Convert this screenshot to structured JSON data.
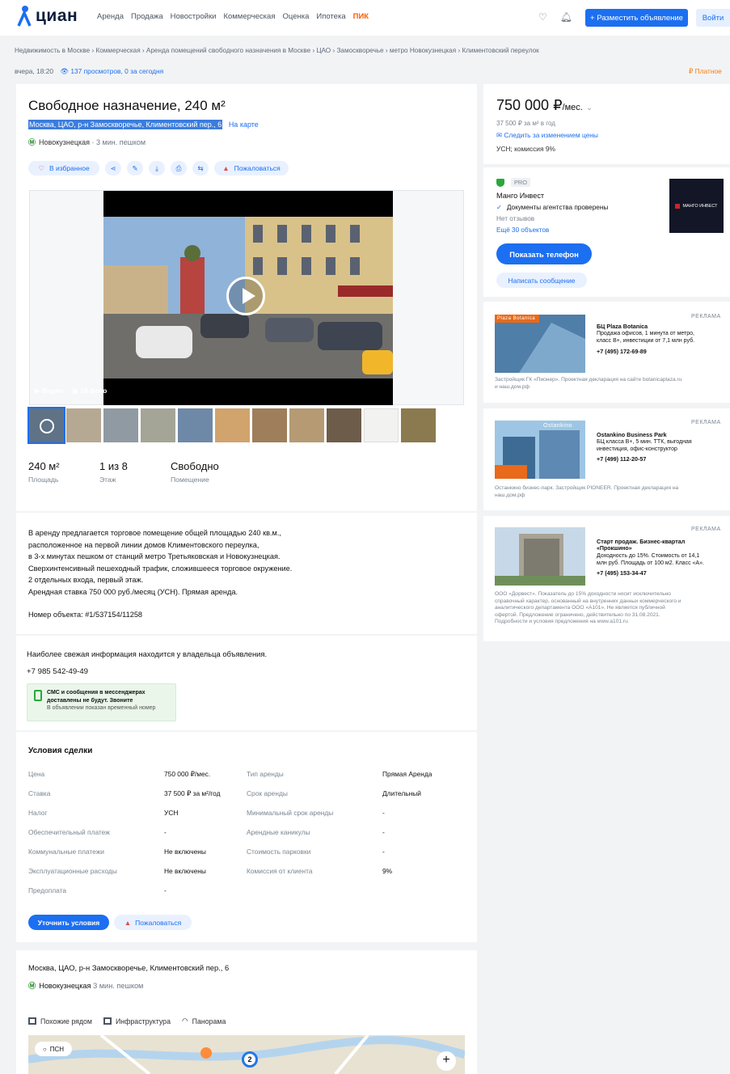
{
  "header": {
    "logo_text": "циан",
    "nav": [
      "Аренда",
      "Продажа",
      "Новостройки",
      "Коммерческая",
      "Оценка",
      "Ипотека"
    ],
    "pik": "ПИК",
    "post_button": "+ Разместить объявление",
    "login_button": "Войти"
  },
  "breadcrumbs": "Недвижимость в Москве  ›  Коммерческая  ›  Аренда помещений свободного назначения в Москве  ›  ЦАО  ›  Замоскворечье  ›  метро Новокузнецкая  ›  Климентовский переулок",
  "meta": {
    "date": "вчера, 18:20",
    "views": "137 просмотров, 0 за сегодня",
    "paid": "₽ Платное"
  },
  "listing": {
    "title": "Свободное назначение, 240 м²",
    "address": "Москва, ЦАО, р-н Замоскворечье, Климентовский пер., 6",
    "on_map": "На карте",
    "metro": "Новокузнецкая",
    "walk": "· 3 мин. пешком",
    "fav_label": "В избранное",
    "complain_label": "Пожаловаться",
    "video_label": "Видео",
    "photos_label": "10 фото",
    "stats": [
      {
        "value": "240 м²",
        "label": "Площадь"
      },
      {
        "value": "1 из 8",
        "label": "Этаж"
      },
      {
        "value": "Свободно",
        "label": "Помещение"
      }
    ],
    "description": [
      "В аренду предлагается торговое помещение общей площадью 240 кв.м.,",
      "расположенное на первой линии домов Климентовского переулка,",
      "в 3-х минутах пешком от станций метро Третьяковская и Новокузнецкая.",
      "Сверхинтенсивный пешеходный трафик, сложившееся торговое окружение.",
      "2 отдельных входа, первый этаж.",
      "Арендная ставка 750 000 руб./месяц (УСН). Прямая аренда."
    ],
    "object_number": "Номер объекта: #1/537154/11258"
  },
  "contact": {
    "fresh": "Наиболее свежая информация находится у владельца объявления.",
    "phone": "+7 985 542-49-49",
    "sms_line1": "СМС и сообщения в мессенджерах",
    "sms_line2": "доставлены не будут. Звоните",
    "sms_note": "В объявлении показан временный номер"
  },
  "deal": {
    "title": "Условия сделки",
    "rows": [
      {
        "l1": "Цена",
        "v1": "750 000 ₽/мес.",
        "l2": "Тип аренды",
        "v2": "Прямая Аренда"
      },
      {
        "l1": "Ставка",
        "v1": "37 500 ₽ за м²/год",
        "l2": "Срок аренды",
        "v2": "Длительный"
      },
      {
        "l1": "Налог",
        "v1": "УСН",
        "l2": "Минимальный срок аренды",
        "v2": "-"
      },
      {
        "l1": "Обеспечительный платеж",
        "v1": "-",
        "l2": "Арендные каникулы",
        "v2": "-"
      },
      {
        "l1": "Коммунальные платежи",
        "v1": "Не включены",
        "l2": "Стоимость парковки",
        "v2": "-"
      },
      {
        "l1": "Эксплуатационные расходы",
        "v1": "Не включены",
        "l2": "Комиссия от клиента",
        "v2": "9%"
      },
      {
        "l1": "Предоплата",
        "v1": "-",
        "l2": "",
        "v2": ""
      }
    ],
    "clarify_btn": "Уточнить условия",
    "complain_btn": "Пожаловаться"
  },
  "location": {
    "address": "Москва, ЦАО, р-н Замоскворечье, Климентовский пер., 6",
    "metro": "Новокузнецкая",
    "walk": "3 мин. пешком",
    "tabs": [
      "Похожие рядом",
      "Инфраструктура",
      "Панорама"
    ],
    "psn": "ПСН",
    "pin": "2",
    "zoom": "+"
  },
  "sidebar": {
    "price": "750 000 ₽",
    "price_unit": "/мес.",
    "ppm": "37 500 ₽ за м² в год",
    "follow": "Следить за изменением цены",
    "tax": "УСН; комиссия 9%",
    "pro": "PRO",
    "agency": "Манго Инвест",
    "verified": "Документы агентства проверены",
    "reviews": "Нет отзывов",
    "more": "Ещё 30 объектов",
    "logo_text": "МАНГО ИНВЕСТ",
    "call": "Показать телефон",
    "message": "Написать сообщение"
  },
  "ads": [
    {
      "tag": "РЕКЛАМА",
      "img_label": "Plaza Botanica",
      "title": "БЦ Plaza Botanica",
      "text": [
        "Продажа офисов, 1 минута от метро,",
        "класс B+, инвестиции от 7,1 млн руб."
      ],
      "phone": "+7 (495) 172-69-89",
      "foot": [
        "Застройщик ГК «Пионер». Проектная декларация на сайте botanicaplaza.ru",
        "и наш.дом.рф"
      ]
    },
    {
      "tag": "РЕКЛАМА",
      "img_label": "Ostankino",
      "title": "Ostankino Business Park",
      "text": [
        "БЦ класса B+, 5 мин. ТТК, выгодная",
        "инвестиция, офис-конструктор"
      ],
      "phone": "+7 (499) 112-20-57",
      "foot": [
        "Останкино бизнес-парк. Застройщик PIONEER. Проектная декларация на",
        "наш.дом.рф"
      ]
    },
    {
      "tag": "РЕКЛАМА",
      "img_label": "",
      "title": "Старт продаж. Бизнес-квартал",
      "text": [
        "«Прокшино»",
        "Доходность до 15%. Стоимость от 14,1",
        "млн руб. Площадь от 100 м2. Класс «А»."
      ],
      "phone": "+7 (495) 153-34-47",
      "foot": [
        "ООО «Дорвест». Показатель до 15% доходности носит исключительно",
        "справочный характер, основанный на внутренних данных коммерческого и",
        "аналитического департамента ООО «А101». Не является публичной",
        "офертой. Предложение ограничено, действительно по 31.08.2021.",
        "Подробности и условия предложения на www.a101.ru"
      ]
    }
  ]
}
